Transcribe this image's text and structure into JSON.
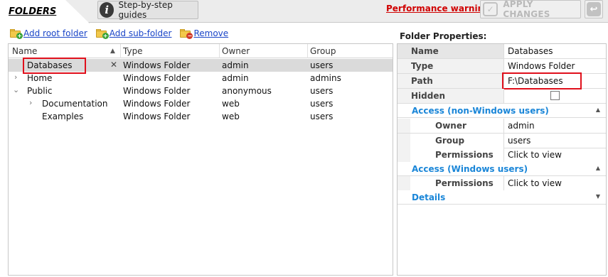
{
  "topbar": {
    "tab_label": "FOLDERS",
    "guides_label": "Step-by-step guides",
    "guides_icon": "info-icon",
    "perf_warning": "Performance warning",
    "apply_label": "APPLY CHANGES",
    "apply_icon": "check-shield-icon",
    "undo_icon": "undo-icon",
    "perf_color": "#d00000"
  },
  "toolbar": {
    "add_root": "Add root folder",
    "add_sub": "Add sub-folder",
    "remove": "Remove"
  },
  "tree": {
    "columns": [
      "Name",
      "Type",
      "Owner",
      "Group"
    ],
    "rows": [
      {
        "name": "Databases",
        "type": "Windows Folder",
        "owner": "admin",
        "group": "users",
        "selected": true
      },
      {
        "name": "Home",
        "type": "Windows Folder",
        "owner": "admin",
        "group": "admins",
        "expander": "collapsed"
      },
      {
        "name": "Public",
        "type": "Windows Folder",
        "owner": "anonymous",
        "group": "users",
        "expander": "expanded"
      },
      {
        "name": "Documentation",
        "type": "Windows Folder",
        "owner": "web",
        "group": "users",
        "expander": "collapsed"
      },
      {
        "name": "Examples",
        "type": "Windows Folder",
        "owner": "web",
        "group": "users"
      }
    ]
  },
  "props": {
    "title": "Folder Properties:",
    "name_key": "Name",
    "name_val": "Databases",
    "type_key": "Type",
    "type_val": "Windows Folder",
    "path_key": "Path",
    "path_val": "F:\\Databases",
    "hidden_key": "Hidden",
    "sec_nonwin": "Access (non-Windows users)",
    "owner_key": "Owner",
    "owner_val": "admin",
    "group_key": "Group",
    "group_val": "users",
    "perm_key": "Permissions",
    "perm_val": "Click to view",
    "sec_win": "Access (Windows users)",
    "perm2_key": "Permissions",
    "perm2_val": "Click to view",
    "sec_details": "Details",
    "accent": "#1a86d8"
  }
}
